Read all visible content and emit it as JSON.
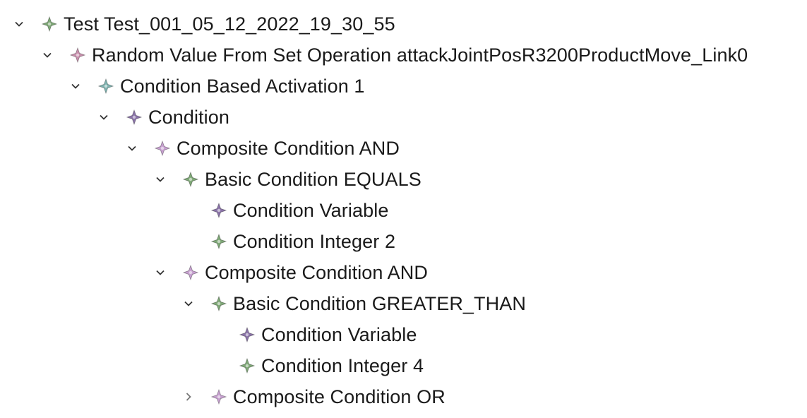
{
  "colors": {
    "twisty": "#333333",
    "twisty_collapsed": "#777777",
    "green": "#7fa877",
    "pink": "#c890ad",
    "teal": "#7fb3b0",
    "purple": "#8a73a8",
    "lilac": "#c6a0cf"
  },
  "tree": [
    {
      "label": "Test Test_001_05_12_2022_19_30_55",
      "depth": 0,
      "state": "expanded",
      "icon": "green"
    },
    {
      "label": "Random Value From Set Operation attackJointPosR3200ProductMove_Link0",
      "depth": 1,
      "state": "expanded",
      "icon": "pink"
    },
    {
      "label": "Condition Based Activation 1",
      "depth": 2,
      "state": "expanded",
      "icon": "teal"
    },
    {
      "label": "Condition",
      "depth": 3,
      "state": "expanded",
      "icon": "purple"
    },
    {
      "label": "Composite Condition AND",
      "depth": 4,
      "state": "expanded",
      "icon": "lilac"
    },
    {
      "label": "Basic Condition EQUALS",
      "depth": 5,
      "state": "expanded",
      "icon": "green"
    },
    {
      "label": "Condition Variable",
      "depth": 6,
      "state": "leaf",
      "icon": "purple"
    },
    {
      "label": "Condition Integer 2",
      "depth": 6,
      "state": "leaf",
      "icon": "green"
    },
    {
      "label": "Composite Condition AND",
      "depth": 5,
      "state": "expanded",
      "icon": "lilac"
    },
    {
      "label": "Basic Condition GREATER_THAN",
      "depth": 6,
      "state": "expanded",
      "icon": "green"
    },
    {
      "label": "Condition Variable",
      "depth": 7,
      "state": "leaf",
      "icon": "purple"
    },
    {
      "label": "Condition Integer 4",
      "depth": 7,
      "state": "leaf",
      "icon": "green"
    },
    {
      "label": "Composite Condition OR",
      "depth": 6,
      "state": "collapsed",
      "icon": "lilac"
    }
  ]
}
